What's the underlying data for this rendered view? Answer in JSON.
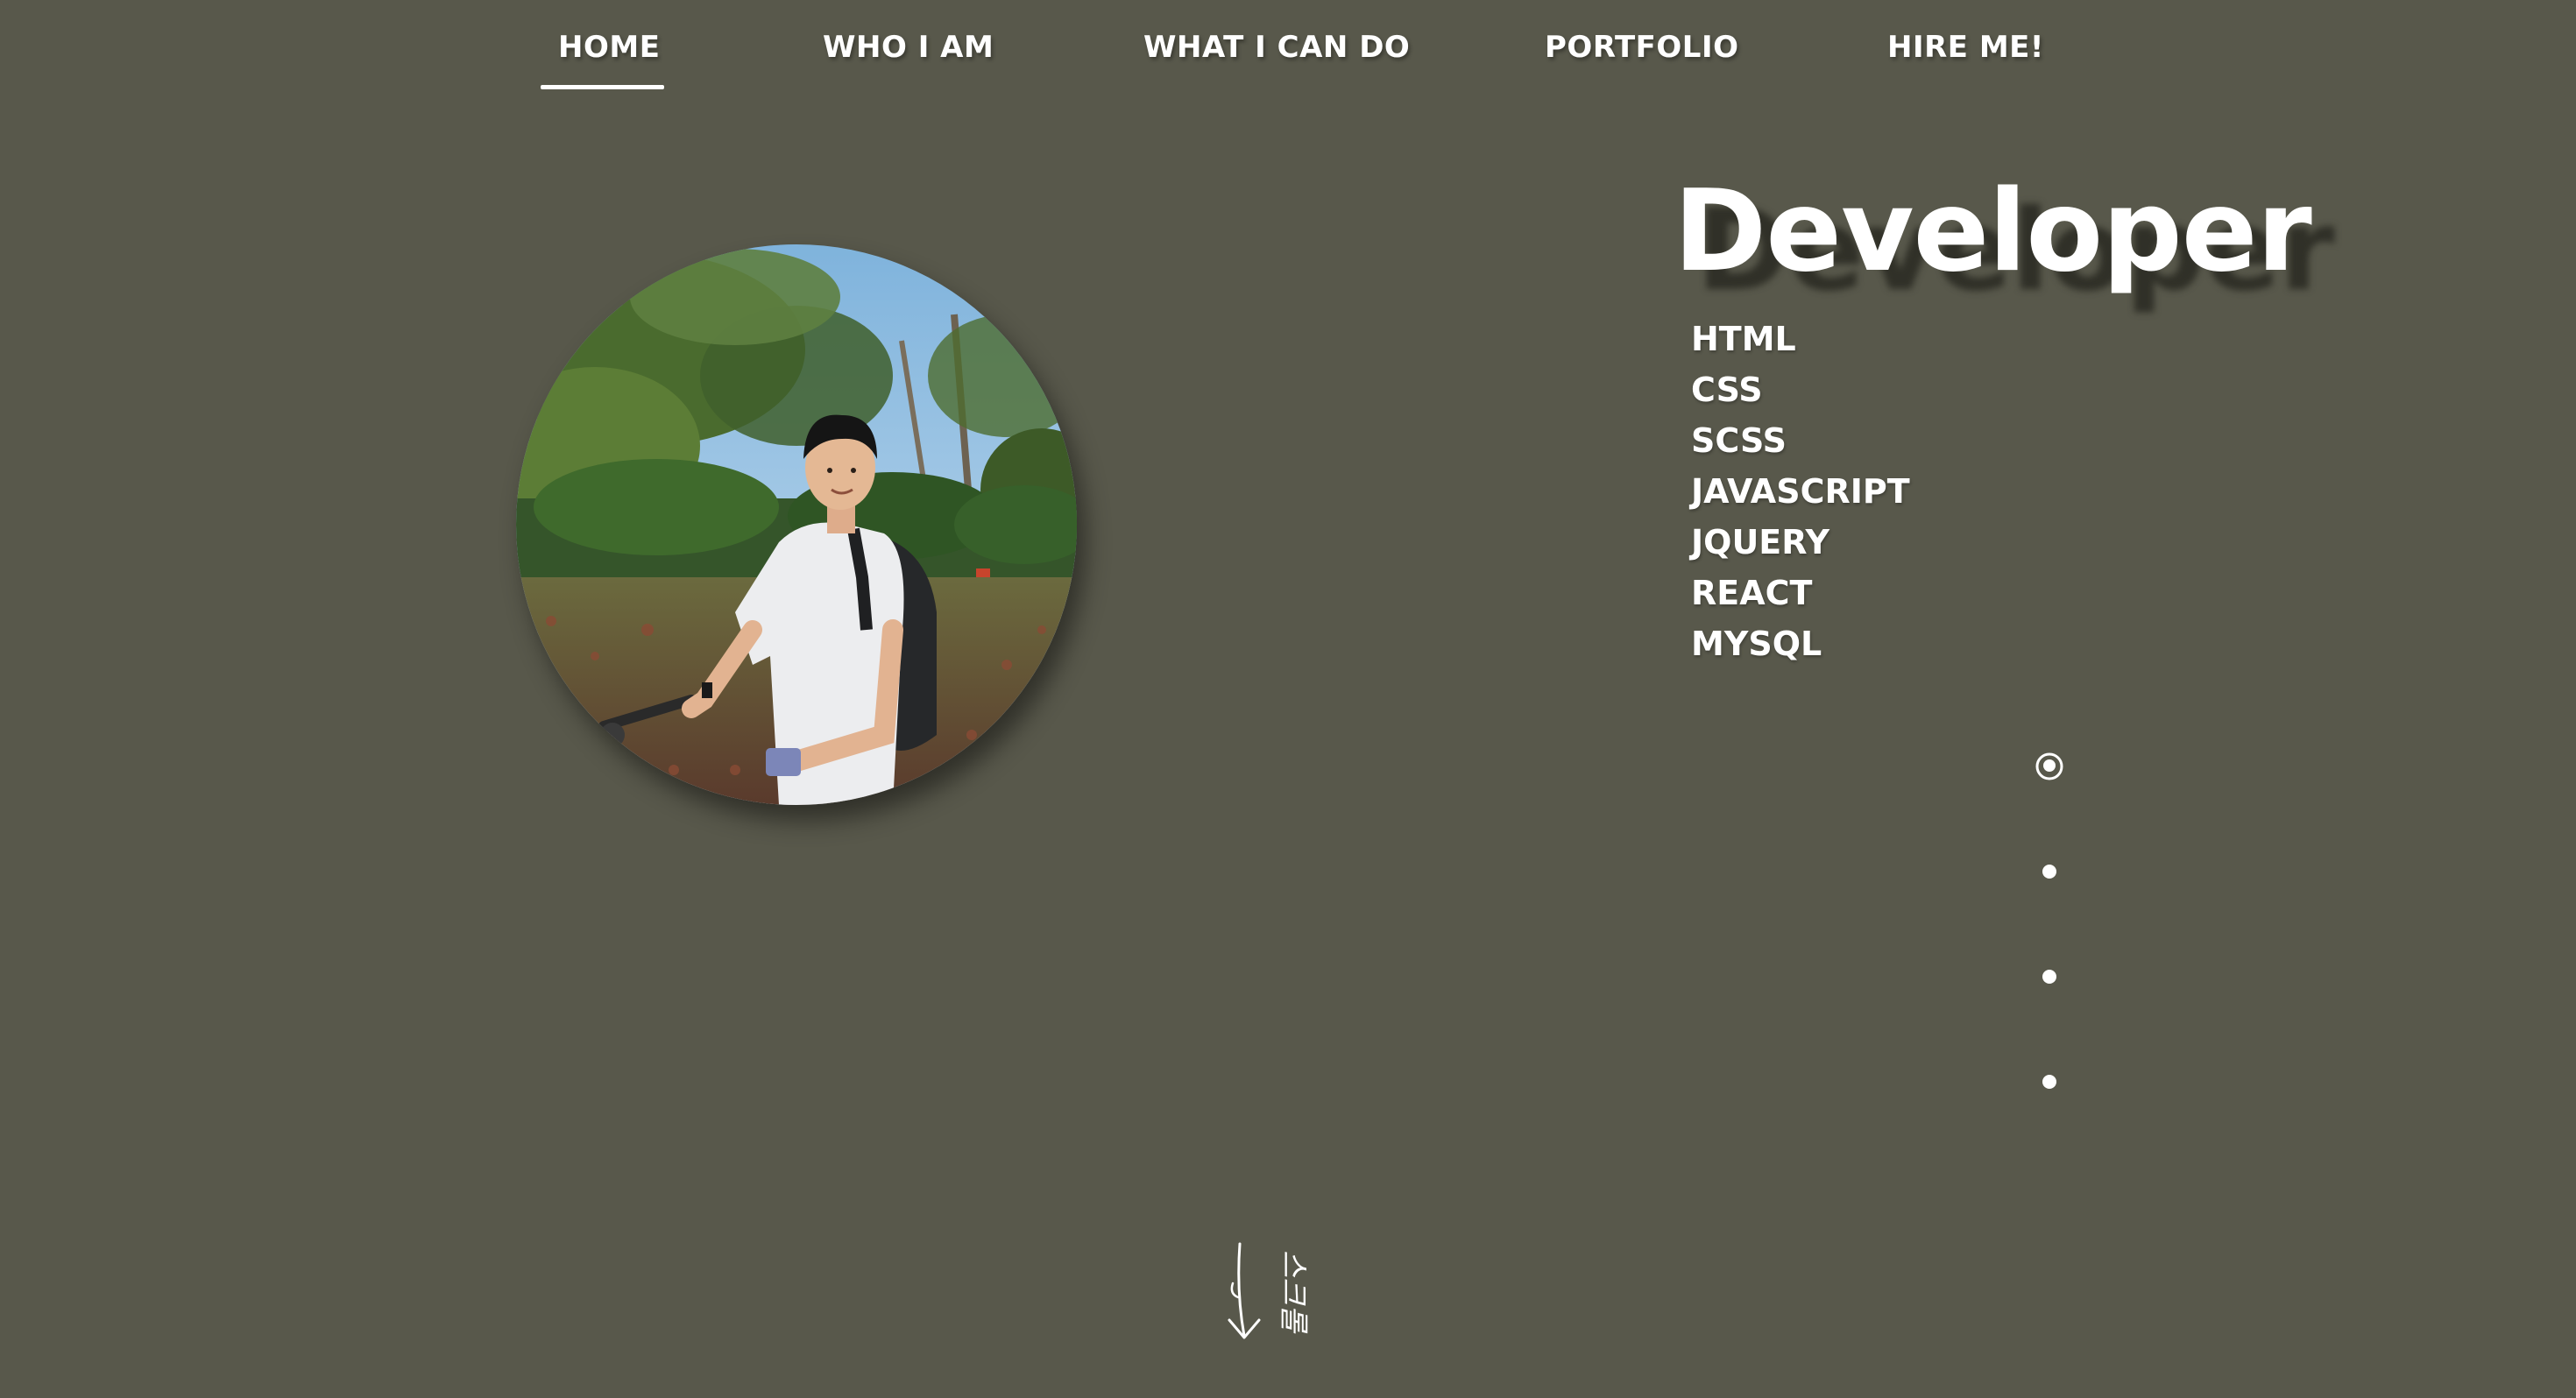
{
  "nav": {
    "items": [
      {
        "label": "HOME",
        "active": true
      },
      {
        "label": "WHO I AM",
        "active": false
      },
      {
        "label": "WHAT I CAN DO",
        "active": false
      },
      {
        "label": "PORTFOLIO",
        "active": false
      },
      {
        "label": "HIRE ME!",
        "active": false
      }
    ]
  },
  "hero": {
    "headline": "Developer",
    "skills": [
      "HTML",
      "CSS",
      "SCSS",
      "JAVASCRIPT",
      "JQUERY",
      "REACT",
      "MYSQL"
    ]
  },
  "pagination": {
    "count": 4,
    "active_index": 0
  },
  "scroll_hint": {
    "text": "스크롤"
  },
  "colors": {
    "background": "#58584b",
    "text": "#ffffff"
  },
  "icons": {
    "profile": "profile-photo",
    "scroll": "scroll-arrow-icon",
    "dots": "pagination-dot-icon"
  }
}
